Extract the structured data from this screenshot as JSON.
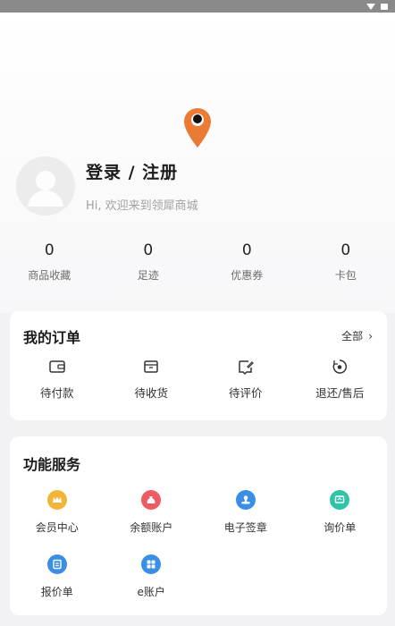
{
  "profile": {
    "login_register": "登录 / 注册",
    "welcome": "Hi, 欢迎来到领犀商城"
  },
  "stats": [
    {
      "value": "0",
      "label": "商品收藏"
    },
    {
      "value": "0",
      "label": "足迹"
    },
    {
      "value": "0",
      "label": "优惠券"
    },
    {
      "value": "0",
      "label": "卡包"
    }
  ],
  "orders": {
    "title": "我的订单",
    "all_label": "全部",
    "items": [
      {
        "label": "待付款",
        "icon": "wallet-icon"
      },
      {
        "label": "待收货",
        "icon": "package-icon"
      },
      {
        "label": "待评价",
        "icon": "review-icon"
      },
      {
        "label": "退还/售后",
        "icon": "refund-icon"
      }
    ]
  },
  "services": {
    "title": "功能服务",
    "items": [
      {
        "label": "会员中心",
        "icon": "crown-icon",
        "color": "#f2b53a"
      },
      {
        "label": "余额账户",
        "icon": "money-bag-icon",
        "color": "#ef5b62"
      },
      {
        "label": "电子签章",
        "icon": "stamp-icon",
        "color": "#3a8ee6"
      },
      {
        "label": "询价单",
        "icon": "inquiry-icon",
        "color": "#2ec4a8"
      },
      {
        "label": "报价单",
        "icon": "quote-icon",
        "color": "#3a8ee6"
      },
      {
        "label": "e账户",
        "icon": "e-account-icon",
        "color": "#3a8ee6"
      }
    ]
  },
  "colors": {
    "accent": "#ea7b35",
    "background": "#f2f2f4"
  }
}
